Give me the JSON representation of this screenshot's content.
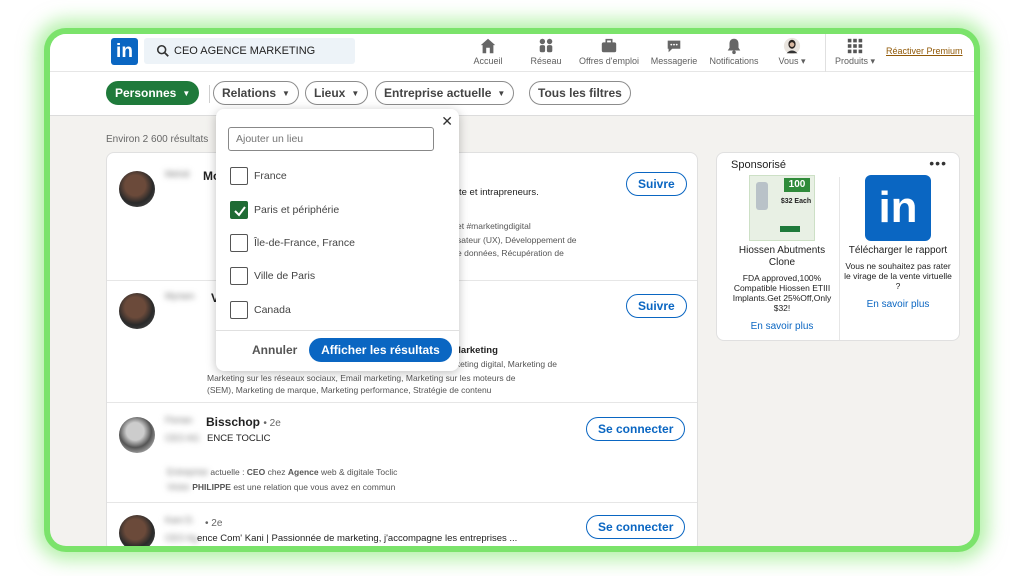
{
  "search": {
    "value": "CEO AGENCE MARKETING"
  },
  "nav": {
    "items": [
      {
        "label": "Accueil",
        "icon": "home-icon"
      },
      {
        "label": "Réseau",
        "icon": "network-icon"
      },
      {
        "label": "Offres d'emploi",
        "icon": "briefcase-icon"
      },
      {
        "label": "Messagerie",
        "icon": "message-icon"
      },
      {
        "label": "Notifications",
        "icon": "bell-icon"
      },
      {
        "label": "Vous",
        "icon": "avatar"
      },
      {
        "label": "Produits",
        "icon": "grid-icon"
      }
    ],
    "premium": "Réactiver Premium"
  },
  "filters": {
    "personnes": "Personnes",
    "relations": "Relations",
    "lieux": "Lieux",
    "entreprise": "Entreprise actuelle",
    "tous": "Tous les filtres"
  },
  "results": {
    "count": "Environ 2 600 résultats",
    "rows": [
      {
        "name": "Mo",
        "l1": "te et intrapreneurs.",
        "l2": "et #marketingdigital",
        "l3": "sateur (UX), Développement de",
        "l4": "e données, Récupération de",
        "button": "Suivre"
      },
      {
        "name": "V",
        "l1": "Marketing",
        "l2": "rketing digital, Marketing de",
        "l3": "Marketing sur les réseaux sociaux, Email marketing, Marketing sur les moteurs de",
        "l4": "(SEM), Marketing de marque, Marketing performance, Stratégie de contenu",
        "button": "Suivre"
      },
      {
        "name": "Bisschop",
        "degree": "• 2e",
        "l1": "ENCE TOCLIC",
        "l2_a": "actuelle  : ",
        "l2_b": "CEO",
        "l2_c": " chez ",
        "l2_d": "Agence",
        "l2_e": " web & digitale Toclic",
        "l3_a": "PHILIPPE",
        "l3_b": " est une relation que vous avez en commun",
        "button": "Se connecter"
      },
      {
        "degree": "• 2e",
        "l1": "ence Com' Kani | Passionnée de marketing, j'accompagne les entreprises ...",
        "button": "Se connecter"
      }
    ]
  },
  "sponsored": {
    "header": "Sponsorisé",
    "ads": [
      {
        "title": "Hiossen Abutments Clone",
        "desc": "FDA approved,100% Compatible Hiossen ETIII Implants.Get 25%Off,Only $32!",
        "more": "En savoir plus",
        "price": "$32 Each"
      },
      {
        "title": "Télécharger le rapport",
        "desc": "Vous ne souhaitez pas rater le virage de la vente virtuelle ?",
        "more": "En savoir plus",
        "logo": "in"
      }
    ]
  },
  "location_dropdown": {
    "placeholder": "Ajouter un lieu",
    "options": [
      {
        "label": "France",
        "checked": false
      },
      {
        "label": "Paris et périphérie",
        "checked": true
      },
      {
        "label": "Île-de-France, France",
        "checked": false
      },
      {
        "label": "Ville de Paris",
        "checked": false
      },
      {
        "label": "Canada",
        "checked": false
      }
    ],
    "cancel": "Annuler",
    "apply": "Afficher les résultats"
  },
  "colors": {
    "brand": "#0a66c2",
    "active_filter": "#1f7a3b",
    "glow": "#7be36b"
  }
}
